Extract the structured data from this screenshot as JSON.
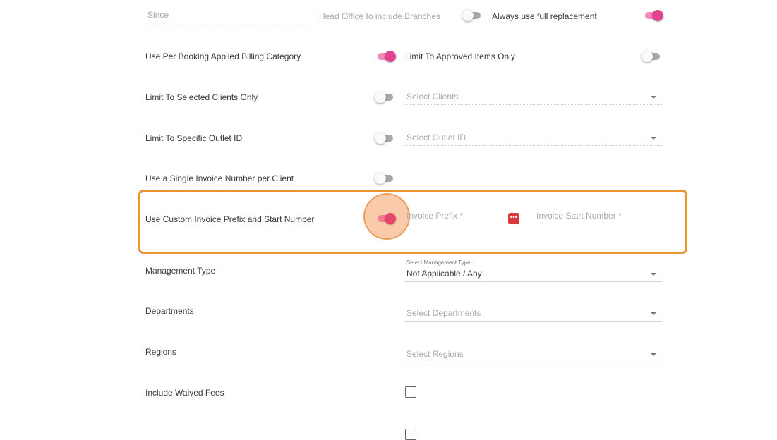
{
  "rows": {
    "since": {
      "placeholder": "Since"
    },
    "head_office": {
      "label": "Head Office to include Branches",
      "enabled": false
    },
    "full_replacement": {
      "label": "Always use full replacement",
      "enabled": true
    },
    "per_booking": {
      "label": "Use Per Booking Applied Billing Category",
      "enabled": true
    },
    "approved_items": {
      "label": "Limit To Approved Items Only",
      "enabled": false
    },
    "selected_clients": {
      "label": "Limit To Selected Clients Only",
      "enabled": false,
      "select_placeholder": "Select Clients"
    },
    "outlet": {
      "label": "Limit To Specific Outlet ID",
      "enabled": false,
      "select_placeholder": "Select Outlet ID"
    },
    "single_invoice": {
      "label": "Use a Single Invoice Number per Client",
      "enabled": false
    },
    "custom_prefix": {
      "label": "Use Custom Invoice Prefix and Start Number",
      "enabled": true,
      "prefix_placeholder": "Invoice Prefix *",
      "start_placeholder": "Invoice Start Number *",
      "password_icon_glyph": "•••"
    },
    "management_type": {
      "label": "Management Type",
      "float_label": "Select Management Type",
      "value": "Not Applicable / Any"
    },
    "departments": {
      "label": "Departments",
      "select_placeholder": "Select Departments"
    },
    "regions": {
      "label": "Regions",
      "select_placeholder": "Select Regions"
    },
    "waived_fees": {
      "label": "Include Waived Fees",
      "checked": false
    }
  },
  "colors": {
    "toggle_on": "#e2448f",
    "highlight_border": "#e8952f",
    "password_icon": "#d9383d"
  },
  "icons": {
    "dropdown": "chevron-down-icon",
    "password_manager": "password-manager-icon"
  }
}
